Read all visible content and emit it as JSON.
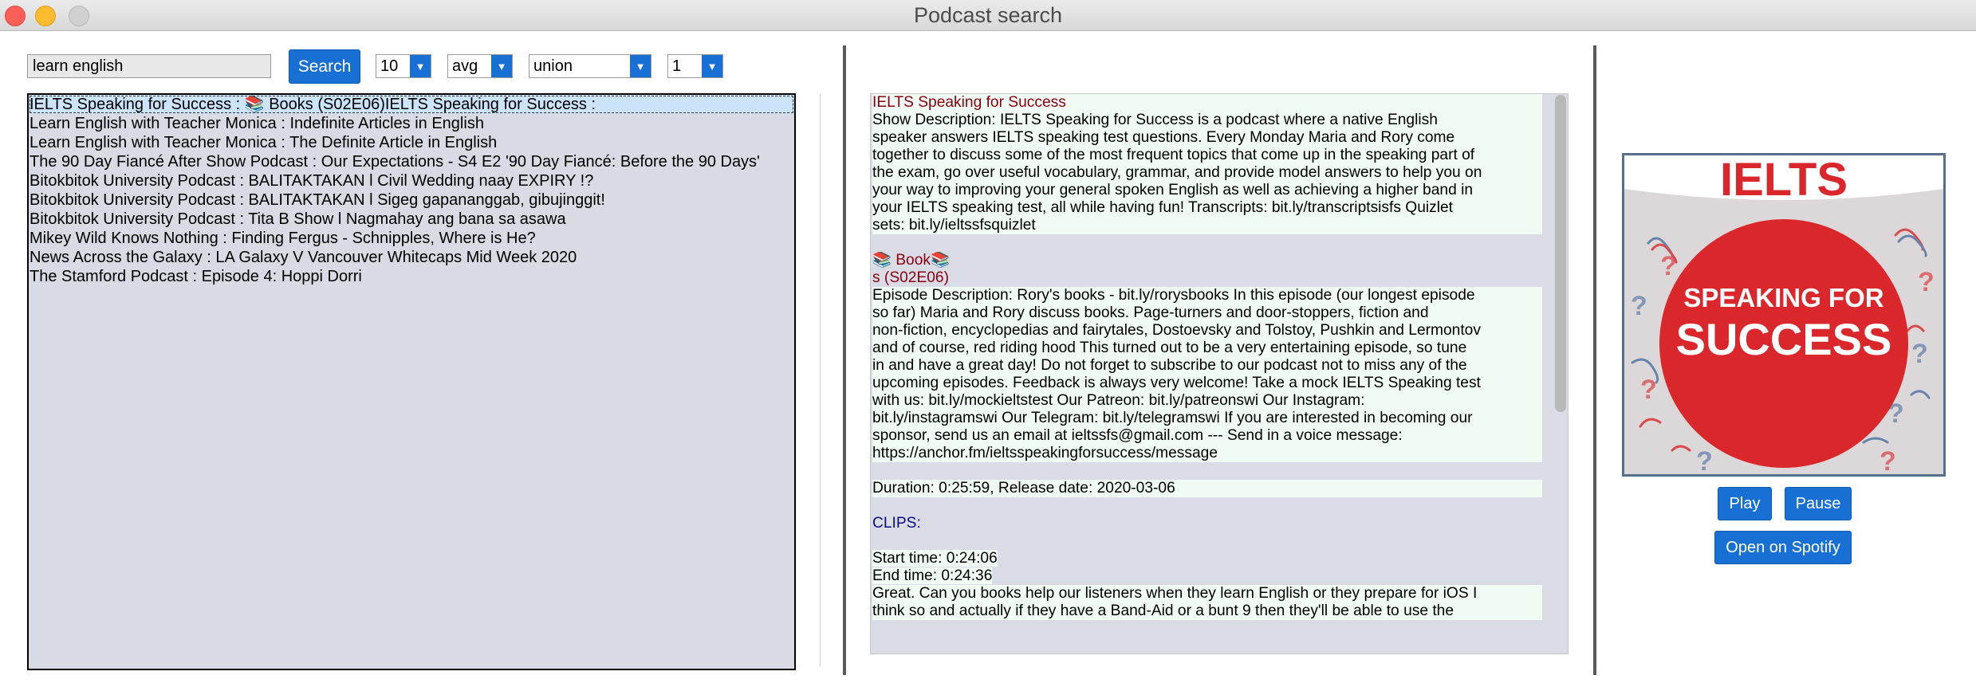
{
  "window": {
    "title": "Podcast search"
  },
  "search": {
    "query": "learn english",
    "button_label": "Search"
  },
  "filters": {
    "count": "10",
    "aggregation": "avg",
    "mode": "union",
    "page": "1"
  },
  "results": [
    "IELTS Speaking for Success  : 📚 Books (S02E06)IELTS Speaking for Success  :",
    "Learn English with Teacher Monica : Indefinite Articles in English",
    "Learn English with Teacher Monica : The Definite Article in English",
    "The 90 Day Fiancé After Show Podcast : Our Expectations - S4 E2 '90 Day Fiancé: Before the 90 Days'",
    "Bitokbitok University Podcast : BALITAKTAKAN l Civil Wedding naay EXPIRY !?",
    "Bitokbitok University Podcast : BALITAKTAKAN l Sigeg gapananggab, gibujinggit!",
    "Bitokbitok University Podcast : Tita B Show l Nagmahay ang bana sa asawa",
    "Mikey Wild Knows Nothing : Finding Fergus - Schnipples, Where is He?",
    "News Across the Galaxy : LA Galaxy V Vancouver Whitecaps Mid Week 2020",
    "The Stamford Podcast : Episode 4: Hoppi Dorri"
  ],
  "details": {
    "show_title": "IELTS Speaking for Success",
    "show_description": [
      "Show Description: IELTS Speaking for Success is a podcast where a native English",
      "speaker answers IELTS speaking test questions.   Every Monday Maria and Rory come",
      "together to discuss some of the most frequent topics that come up in the speaking part of",
      "the exam, go over useful vocabulary, grammar, and provide model answers to help you on",
      "your way to improving your general spoken English as well as achieving a higher band in",
      "your IELTS speaking test, all while having fun!   Transcripts: bit.ly/transcriptsisfs Quizlet",
      "sets: bit.ly/ieltssfsquizlet"
    ],
    "episode_title_line1": "📚 Book📚",
    "episode_title_line2": "s (S02E06)",
    "episode_description": [
      "Episode Description: Rory's books - bit.ly/rorysbooks  In this episode (our longest episode",
      "so far) Maria and Rory discuss books. Page-turners and door-stoppers, fiction and",
      "non-fiction, encyclopedias and fairytales, Dostoevsky and Tolstoy, Pushkin and Lermontov",
      "and of course, red riding hood  This turned out to be a very entertaining episode, so tune",
      "in and have a great day! Do not forget to subscribe to our podcast not to miss any of the",
      "upcoming episodes. Feedback is always very welcome! Take a mock IELTS Speaking test",
      "with us: bit.ly/mockieltstest Our Patreon: bit.ly/patreonswi Our Instagram:",
      "bit.ly/instagramswi  Our Telegram: bit.ly/telegramswi If you are interested in becoming our",
      "sponsor, send us an email at ieltssfs@gmail.com  ---   Send in a voice message:",
      "https://anchor.fm/ieltsspeakingforsuccess/message"
    ],
    "duration_line": "Duration: 0:25:59, Release date: 2020-03-06",
    "clips_label": "CLIPS:",
    "start_time": "Start time:  0:24:06",
    "end_time": "End time:  0:24:36",
    "clip_text": [
      " Great. Can you books help our listeners when they learn English or they prepare for iOS I",
      "think so and actually if they have a Band-Aid or a bunt 9 then they'll be able to use the"
    ]
  },
  "artwork": {
    "line1": "IELTS",
    "line2": "SPEAKING FOR",
    "line3": "SUCCESS"
  },
  "player": {
    "play_label": "Play",
    "pause_label": "Pause",
    "spotify_label": "Open on Spotify"
  },
  "colors": {
    "accent": "#1870d5",
    "title_red": "#8b0010",
    "clips_blue": "#0b0b8c",
    "art_red": "#d9272b"
  }
}
